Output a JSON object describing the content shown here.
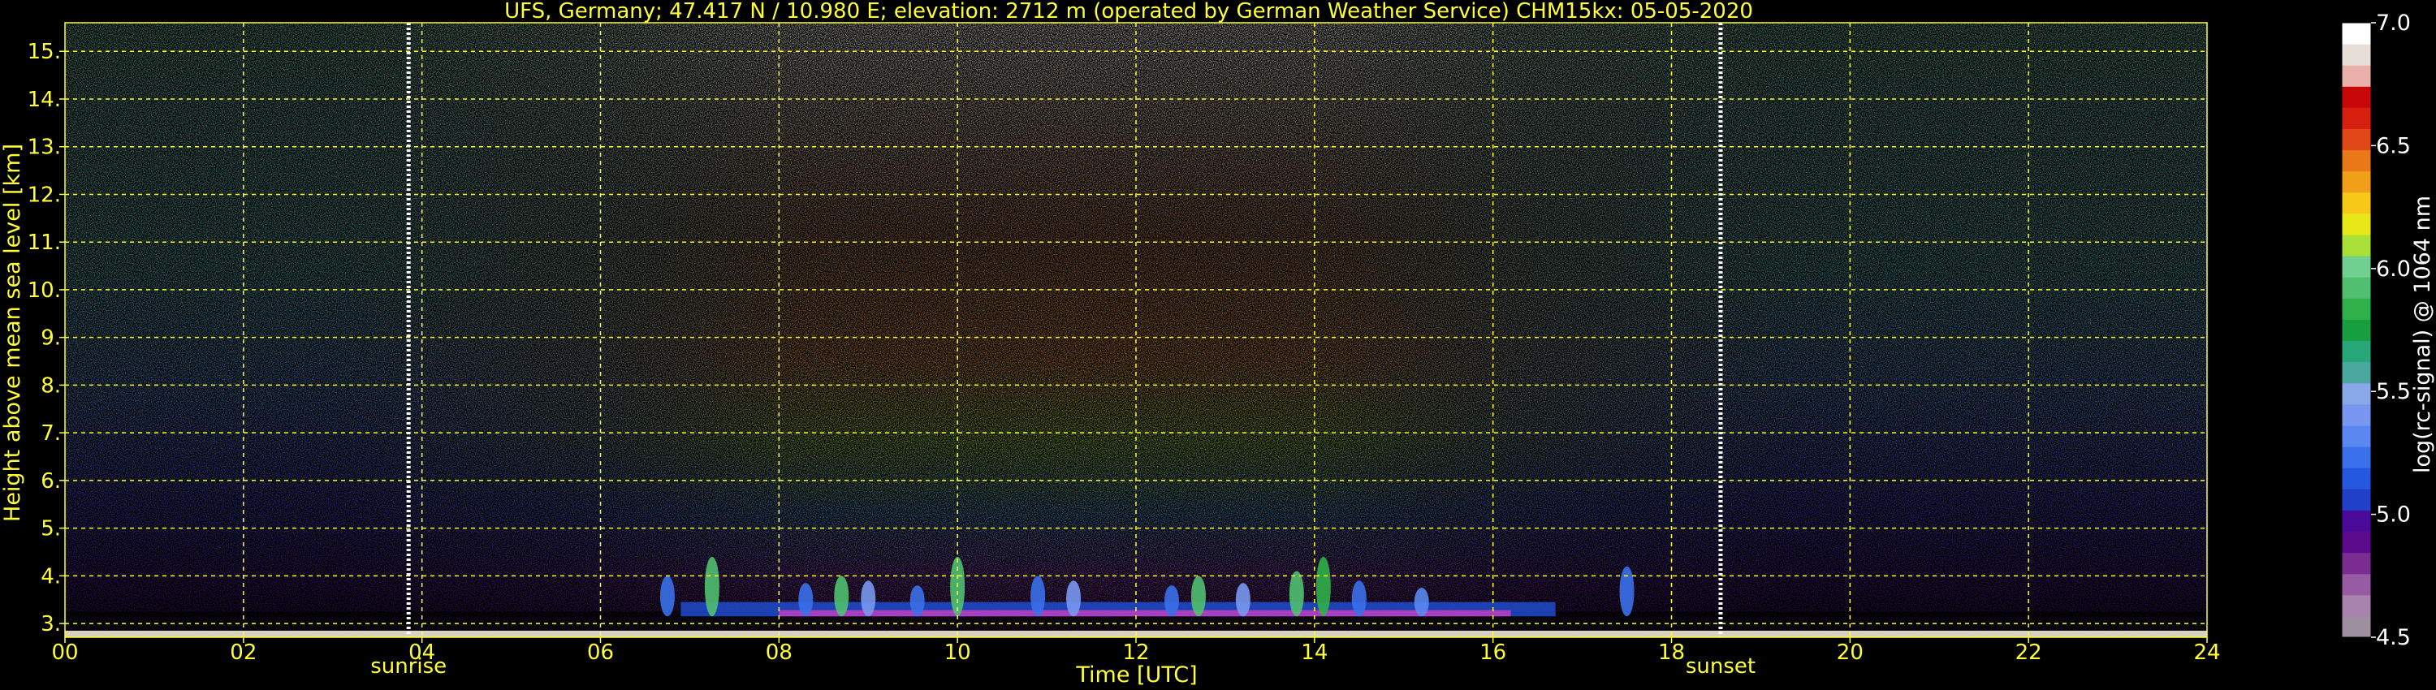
{
  "chart_data": {
    "type": "heatmap",
    "title": "UFS, Germany; 47.417 N / 10.980 E; elevation: 2712 m  (operated by German Weather Service)    CHM15kx: 05-05-2020",
    "xlabel": "Time [UTC]",
    "ylabel": "Height above mean sea level [km]",
    "xlim": [
      0,
      24
    ],
    "ylim": [
      2.712,
      15.6
    ],
    "x_ticks": [
      0,
      2,
      4,
      6,
      8,
      10,
      12,
      14,
      16,
      18,
      20,
      22,
      24
    ],
    "x_tick_labels": [
      "00",
      "02",
      "04",
      "06",
      "08",
      "10",
      "12",
      "14",
      "16",
      "18",
      "20",
      "22",
      "24"
    ],
    "y_ticks": [
      3,
      4,
      5,
      6,
      7,
      8,
      9,
      10,
      11,
      12,
      13,
      14,
      15
    ],
    "y_tick_labels": [
      "3.",
      "4.",
      "5.",
      "6.",
      "7.",
      "8.",
      "9.",
      "10.",
      "11.",
      "12.",
      "13.",
      "14.",
      "15."
    ],
    "grid": true,
    "events": [
      {
        "label": "sunrise",
        "time": 3.85
      },
      {
        "label": "sunset",
        "time": 18.55
      }
    ],
    "colorbar": {
      "label": "log(rc-signal) @ 1064 nm",
      "range": [
        4.5,
        7.0
      ],
      "tick_values": [
        4.5,
        5.0,
        5.5,
        6.0,
        6.5,
        7.0
      ],
      "tick_labels": [
        "4.5",
        "5.0",
        "5.5",
        "6.0",
        "6.5",
        "7.0"
      ],
      "colors": [
        "#9e8fa0",
        "#a883ad",
        "#975aa3",
        "#7a2c91",
        "#5a0a8a",
        "#4a0a9a",
        "#2040c8",
        "#2458e0",
        "#3a70ea",
        "#5a88f0",
        "#7898f0",
        "#88a8e8",
        "#4aa8a0",
        "#28a878",
        "#18a040",
        "#30b048",
        "#50c070",
        "#70d090",
        "#a8e038",
        "#e8e818",
        "#f8c818",
        "#f0a018",
        "#e87818",
        "#e04818",
        "#d82010",
        "#c80808",
        "#e8b0a8",
        "#e8e0d8",
        "#ffffff"
      ]
    }
  }
}
